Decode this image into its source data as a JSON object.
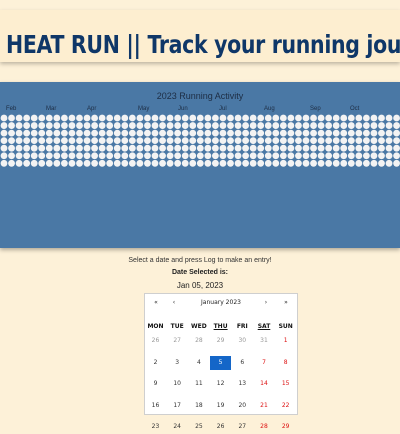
{
  "header": {
    "title": "HEAT RUN || Track your running journey"
  },
  "heatmap": {
    "title": "2023 Running Activity",
    "months": [
      "Feb",
      "Mar",
      "Apr",
      "May",
      "Jun",
      "Jul",
      "Aug",
      "Sep",
      "Oct"
    ],
    "cell_color": "#f3f3f3",
    "background": "#4a78a5"
  },
  "entry": {
    "hint": "Select a date and press Log to make an entry!",
    "selected_label": "Date Selected is:",
    "selected_value": "Jan 05, 2023"
  },
  "calendar": {
    "prev_year": "«",
    "prev_month": "‹",
    "month_label": "January 2023",
    "next_month": "›",
    "next_year": "»",
    "weekdays": [
      "MON",
      "TUE",
      "WED",
      "THU",
      "FRI",
      "SAT",
      "SUN"
    ],
    "underlined_weekdays": [
      "THU",
      "SAT"
    ],
    "weeks": [
      [
        "26",
        "27",
        "28",
        "29",
        "30",
        "31",
        "1"
      ],
      [
        "2",
        "3",
        "4",
        "5",
        "6",
        "7",
        "8"
      ],
      [
        "9",
        "10",
        "11",
        "12",
        "13",
        "14",
        "15"
      ],
      [
        "16",
        "17",
        "18",
        "19",
        "20",
        "21",
        "22"
      ],
      [
        "23",
        "24",
        "25",
        "26",
        "27",
        "28",
        "29"
      ]
    ],
    "muted_cells": [
      [
        0,
        0
      ],
      [
        0,
        1
      ],
      [
        0,
        2
      ],
      [
        0,
        3
      ],
      [
        0,
        4
      ],
      [
        0,
        5
      ]
    ],
    "selected_cell": [
      1,
      3
    ],
    "weekend_columns": [
      5,
      6
    ]
  }
}
